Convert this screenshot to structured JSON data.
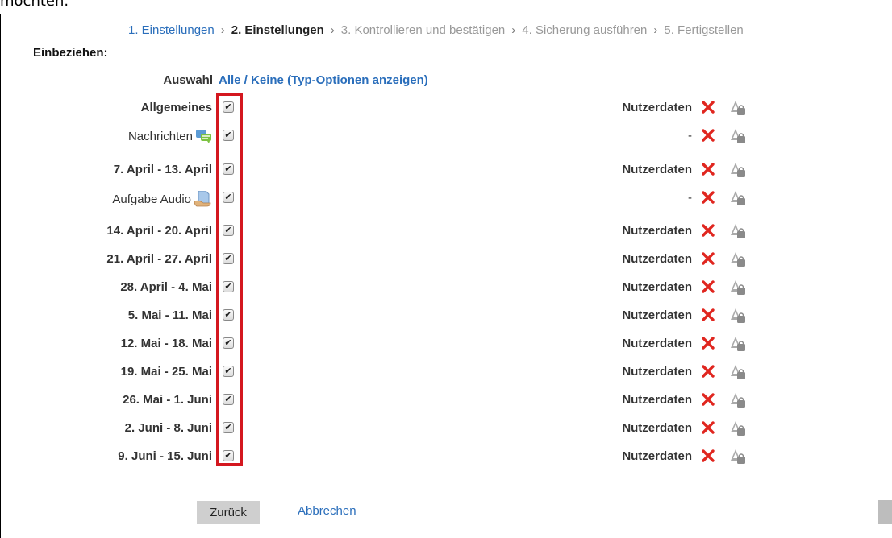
{
  "top_text": "möchten.",
  "breadcrumb": [
    {
      "label": "1. Einstellungen",
      "state": "link"
    },
    {
      "label": "2. Einstellungen",
      "state": "current"
    },
    {
      "label": "3. Kontrollieren und bestätigen",
      "state": "future"
    },
    {
      "label": "4. Sicherung ausführen",
      "state": "future"
    },
    {
      "label": "5. Fertigstellen",
      "state": "future"
    }
  ],
  "breadcrumb_separator": "›",
  "section_heading": "Einbeziehen:",
  "selector": {
    "label": "Auswahl",
    "all": "Alle",
    "slash": " / ",
    "none": "Keine",
    "options_link": "(Typ-Optionen anzeigen)"
  },
  "rows": [
    {
      "label": "Allgemeines",
      "bold": true,
      "icon": null,
      "checked": true,
      "userdata": "Nutzerdaten"
    },
    {
      "label": "Nachrichten",
      "bold": false,
      "icon": "forum-icon",
      "checked": true,
      "userdata": "-"
    },
    {
      "label": "7. April - 13. April",
      "bold": true,
      "icon": null,
      "checked": true,
      "userdata": "Nutzerdaten"
    },
    {
      "label": "Aufgabe Audio",
      "bold": false,
      "icon": "assignment-icon",
      "checked": true,
      "userdata": "-"
    },
    {
      "label": "14. April - 20. April",
      "bold": true,
      "icon": null,
      "checked": true,
      "userdata": "Nutzerdaten"
    },
    {
      "label": "21. April - 27. April",
      "bold": true,
      "icon": null,
      "checked": true,
      "userdata": "Nutzerdaten"
    },
    {
      "label": "28. April - 4. Mai",
      "bold": true,
      "icon": null,
      "checked": true,
      "userdata": "Nutzerdaten"
    },
    {
      "label": "5. Mai - 11. Mai",
      "bold": true,
      "icon": null,
      "checked": true,
      "userdata": "Nutzerdaten"
    },
    {
      "label": "12. Mai - 18. Mai",
      "bold": true,
      "icon": null,
      "checked": true,
      "userdata": "Nutzerdaten"
    },
    {
      "label": "19. Mai - 25. Mai",
      "bold": true,
      "icon": null,
      "checked": true,
      "userdata": "Nutzerdaten"
    },
    {
      "label": "26. Mai - 1. Juni",
      "bold": true,
      "icon": null,
      "checked": true,
      "userdata": "Nutzerdaten"
    },
    {
      "label": "2. Juni - 8. Juni",
      "bold": true,
      "icon": null,
      "checked": true,
      "userdata": "Nutzerdaten"
    },
    {
      "label": "9. Juni - 15. Juni",
      "bold": true,
      "icon": null,
      "checked": true,
      "userdata": "Nutzerdaten"
    }
  ],
  "row_icons": {
    "remove": "red-x-icon",
    "lock": "locked-user-data-icon"
  },
  "buttons": {
    "back": "Zurück",
    "cancel": "Abbrechen"
  },
  "colors": {
    "link": "#2a6ebb",
    "highlight_box": "#d4171f",
    "remove_icon": "#e0261f"
  }
}
